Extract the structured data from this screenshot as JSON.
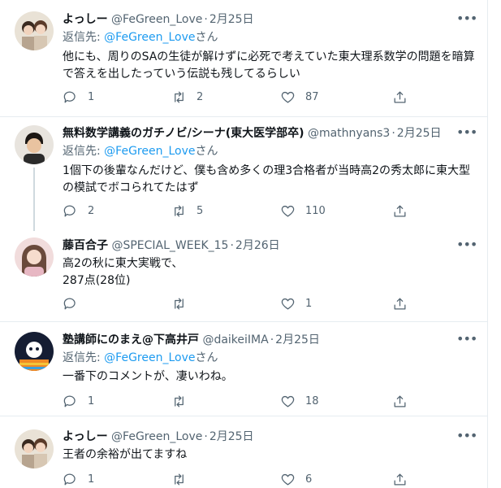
{
  "tweets": [
    {
      "name": "よっしー",
      "handle": "@FeGreen_Love",
      "date": "2月25日",
      "reply_prefix": "返信先: ",
      "reply_mention": "@FeGreen_Love",
      "reply_suffix": "さん",
      "text_lines": [
        "他にも、周りのSAの生徒が解けずに必死で考えていた東大理系数学の問題を暗算",
        "で答えを出したっていう伝説も残してるらしい"
      ],
      "replies": "1",
      "retweets": "2",
      "likes": "87",
      "avatar_color": "#c9a98e"
    },
    {
      "name": "無料数学講義のガチノビ/シーナ(東大医学部卒)",
      "handle": "@mathnyans3",
      "date": "2月25日",
      "reply_prefix": "返信先: ",
      "reply_mention": "@FeGreen_Love",
      "reply_suffix": "さん",
      "text_lines": [
        "1個下の後輩なんだけど、僕も含め多くの理3合格者が当時高2の秀太郎に東大型",
        "の模試でボコられてたはず"
      ],
      "replies": "2",
      "retweets": "5",
      "likes": "110",
      "avatar_color": "#d8c2a8"
    },
    {
      "name": "藤百合子",
      "handle": "@SPECIAL_WEEK_15",
      "date": "2月26日",
      "text_lines": [
        "高2の秋に東大実戦で、",
        "287点(28位)"
      ],
      "replies": "",
      "retweets": "",
      "likes": "1",
      "avatar_color": "#e8b9b9"
    },
    {
      "name": "塾講師にのまえ@下高井戸",
      "handle": "@daikeiIMA",
      "date": "2月25日",
      "reply_prefix": "返信先: ",
      "reply_mention": "@FeGreen_Love",
      "reply_suffix": "さん",
      "text_lines": [
        "一番下のコメントが、凄いわね。"
      ],
      "replies": "1",
      "retweets": "",
      "likes": "18",
      "avatar_color": "#1f2a44"
    },
    {
      "name": "よっしー",
      "handle": "@FeGreen_Love",
      "date": "2月25日",
      "text_lines": [
        "王者の余裕が出てますね"
      ],
      "replies": "1",
      "retweets": "",
      "likes": "6",
      "avatar_color": "#c9a98e"
    }
  ],
  "colors": {
    "link": "#1d9bf0",
    "muted": "#536471",
    "thread_line": "#cfd9de",
    "divider": "#e6ecf0"
  },
  "icons": [
    "reply-icon",
    "retweet-icon",
    "like-icon",
    "share-icon",
    "more-icon"
  ]
}
